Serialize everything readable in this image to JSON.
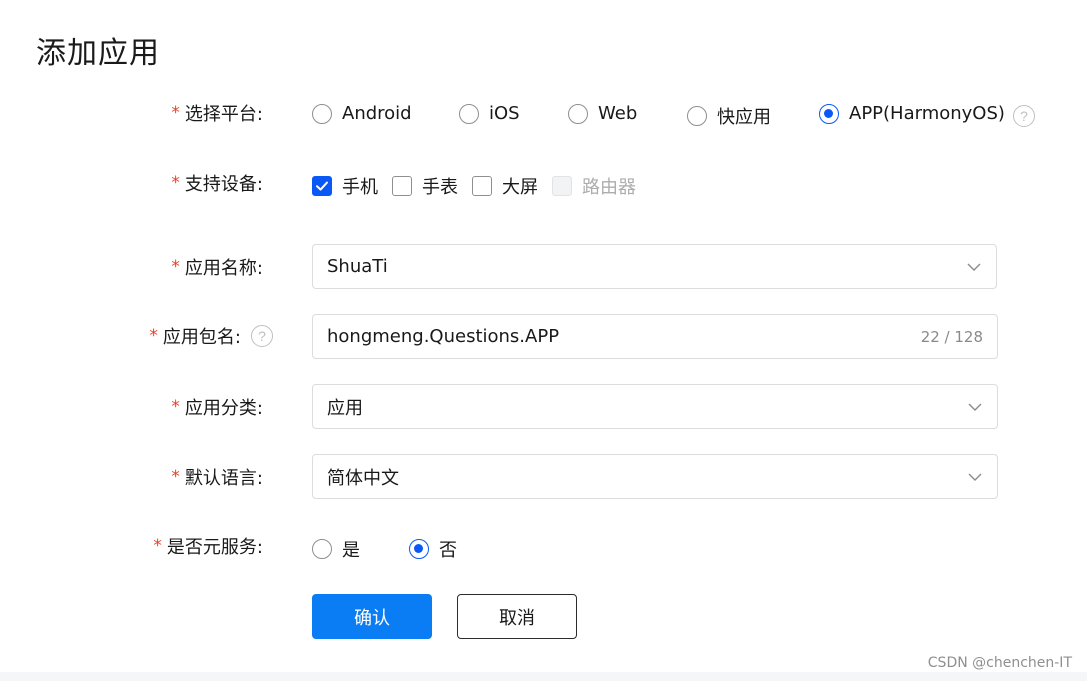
{
  "title": "添加应用",
  "required_mark": "*",
  "help_glyph": "?",
  "platform": {
    "label": "选择平台:",
    "options": [
      "Android",
      "iOS",
      "Web",
      "快应用",
      "APP(HarmonyOS)"
    ],
    "selected": "APP(HarmonyOS)"
  },
  "devices": {
    "label": "支持设备:",
    "options": [
      {
        "label": "手机",
        "checked": true,
        "disabled": false
      },
      {
        "label": "手表",
        "checked": false,
        "disabled": false
      },
      {
        "label": "大屏",
        "checked": false,
        "disabled": false
      },
      {
        "label": "路由器",
        "checked": false,
        "disabled": true
      }
    ]
  },
  "app_name": {
    "label": "应用名称:",
    "value": "ShuaTi"
  },
  "package_name": {
    "label": "应用包名:",
    "value": "hongmeng.Questions.APP",
    "counter": "22 / 128"
  },
  "category": {
    "label": "应用分类:",
    "value": "应用"
  },
  "language": {
    "label": "默认语言:",
    "value": "简体中文"
  },
  "atomic_service": {
    "label": "是否元服务:",
    "options": [
      "是",
      "否"
    ],
    "selected": "否"
  },
  "buttons": {
    "confirm": "确认",
    "cancel": "取消"
  },
  "watermark": "CSDN @chenchen-IT",
  "colors": {
    "accent": "#0a59f7",
    "primary_button": "#0a7df5",
    "required": "#e84026"
  }
}
